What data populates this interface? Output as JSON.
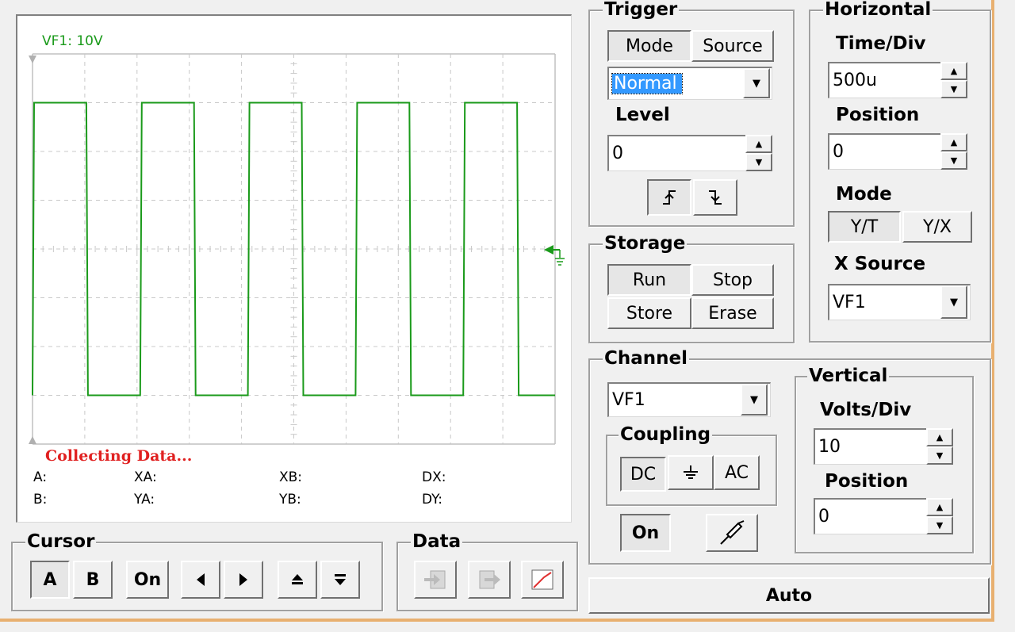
{
  "scope": {
    "channel_label": "VF1: 10V",
    "status": "Collecting Data...",
    "readouts": {
      "a": "A:",
      "b": "B:",
      "xa": "XA:",
      "ya": "YA:",
      "xb": "XB:",
      "yb": "YB:",
      "dx": "DX:",
      "dy": "DY:"
    },
    "trace_color": "#1a9a1a"
  },
  "cursor": {
    "title": "Cursor",
    "a": "A",
    "b": "B",
    "on": "On",
    "left_icon": "triangle-left-icon",
    "right_icon": "triangle-right-icon",
    "up_icon": "arrow-up-icon",
    "down_icon": "arrow-down-icon"
  },
  "data": {
    "title": "Data",
    "icons": [
      "import-data-icon",
      "export-data-icon",
      "curve-icon"
    ]
  },
  "trigger": {
    "title": "Trigger",
    "mode_tab": "Mode",
    "source_tab": "Source",
    "mode_value": "Normal",
    "level_label": "Level",
    "level_value": "0",
    "rising_icon": "rising-edge-icon",
    "falling_icon": "falling-edge-icon"
  },
  "storage": {
    "title": "Storage",
    "run": "Run",
    "stop": "Stop",
    "store": "Store",
    "erase": "Erase"
  },
  "horizontal": {
    "title": "Horizontal",
    "timediv_label": "Time/Div",
    "timediv_value": "500u",
    "position_label": "Position",
    "position_value": "0",
    "mode_label": "Mode",
    "yt": "Y/T",
    "yx": "Y/X",
    "xsource_label": "X Source",
    "xsource_value": "VF1"
  },
  "channel": {
    "title": "Channel",
    "value": "VF1",
    "coupling_label": "Coupling",
    "dc": "DC",
    "ac": "AC",
    "ground_icon": "ground-icon",
    "on": "On",
    "probe_icon": "probe-icon"
  },
  "vertical": {
    "title": "Vertical",
    "voltsdiv_label": "Volts/Div",
    "voltsdiv_value": "10",
    "position_label": "Position",
    "position_value": "0"
  },
  "auto": "Auto"
}
